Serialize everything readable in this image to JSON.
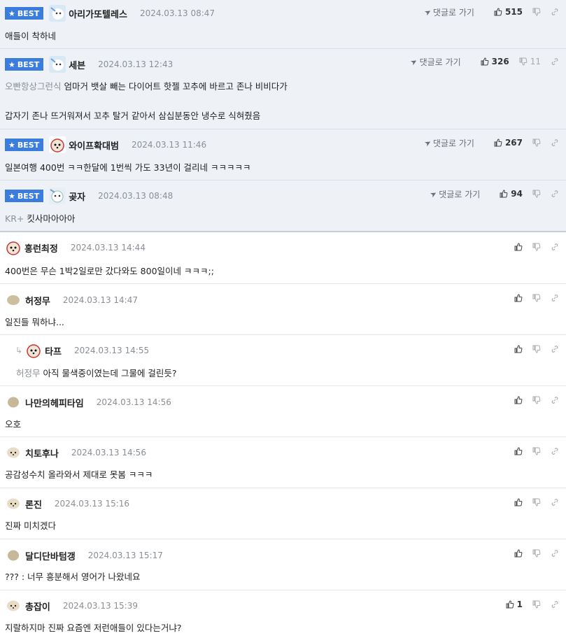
{
  "best_label": "BEST",
  "goto_label": "댓글로 가기",
  "comments": [
    {
      "nick": "아리가또텔레스",
      "date": "2024.03.13 08:47",
      "text": "애들이 착하네",
      "prefix": "",
      "up": "515",
      "down": "",
      "best": true
    },
    {
      "nick": "세븐",
      "date": "2024.03.13 12:43",
      "text": "엄마거 뱃살 빼는 다이어트 핫젤 꼬추에 바르고 존나 비비다가",
      "text2": "갑자기 존나 뜨거워져서 꼬추 탈거 같아서 삼십분동안 냉수로 식혀줬음",
      "prefix": "오빤항상그런식",
      "up": "326",
      "down": "11",
      "best": true
    },
    {
      "nick": "와이프확대범",
      "date": "2024.03.13 11:46",
      "text": "일본여행 400번 ㅋㅋ한달에 1번씩 가도 33년이 걸리네 ㅋㅋㅋㅋㅋ",
      "prefix": "",
      "up": "267",
      "down": "",
      "best": true
    },
    {
      "nick": "곶자",
      "date": "2024.03.13 08:48",
      "text": "킷사마아아아",
      "prefix": "KR+",
      "up": "94",
      "down": "",
      "best": true
    },
    {
      "nick": "홍런최정",
      "date": "2024.03.13 14:44",
      "text": "400번은 무슨 1박2일로만 갔다와도 800일이네 ㅋㅋㅋ;;",
      "prefix": "",
      "up": "",
      "down": "",
      "best": false
    },
    {
      "nick": "허정무",
      "date": "2024.03.13 14:47",
      "text": "일진들 뭐하냐...",
      "prefix": "",
      "up": "",
      "down": "",
      "best": false
    },
    {
      "nick": "타프",
      "date": "2024.03.13 14:55",
      "text": "아직 물색중이였는데 그물에 걸린듯?",
      "prefix": "허정무",
      "up": "",
      "down": "",
      "best": false,
      "reply": true
    },
    {
      "nick": "나만의헤피타임",
      "date": "2024.03.13 14:56",
      "text": "오호",
      "prefix": "",
      "up": "",
      "down": "",
      "best": false
    },
    {
      "nick": "치토후나",
      "date": "2024.03.13 14:56",
      "text": "공감성수치 올라와서 제대로 못봄 ㅋㅋㅋ",
      "prefix": "",
      "up": "",
      "down": "",
      "best": false
    },
    {
      "nick": "론진",
      "date": "2024.03.13 15:16",
      "text": "진짜 미치겠다",
      "prefix": "",
      "up": "",
      "down": "",
      "best": false
    },
    {
      "nick": "달디단바텀갱",
      "date": "2024.03.13 15:17",
      "text": "??? : 너무 흥분해서 영어가 나왔네요",
      "prefix": "",
      "up": "",
      "down": "",
      "best": false
    },
    {
      "nick": "총잡이",
      "date": "2024.03.13 15:39",
      "text": "지랄하지마 진짜 요즘엔 저런애들이 있다는거냐?",
      "prefix": "",
      "up": "1",
      "down": "",
      "best": false
    }
  ],
  "colors": {
    "best_badge": "#3b7ddd",
    "best_bg": "#eef2f7",
    "date": "#8a8f96"
  }
}
